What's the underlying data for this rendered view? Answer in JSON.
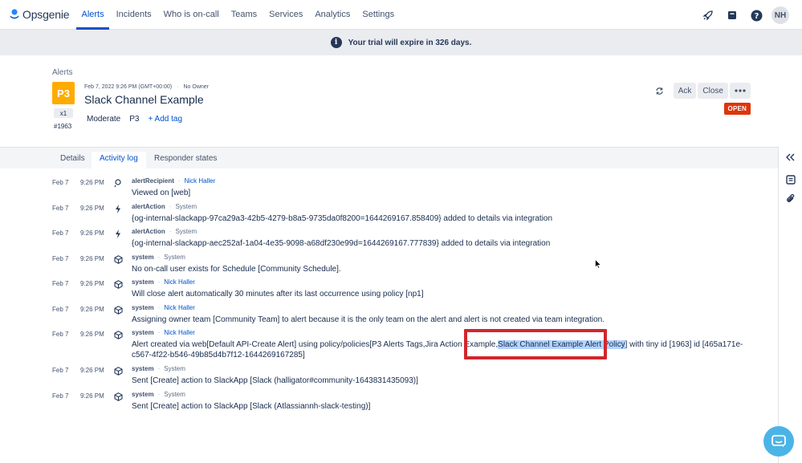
{
  "app": {
    "name": "Opsgenie"
  },
  "nav": {
    "items": [
      "Alerts",
      "Incidents",
      "Who is on-call",
      "Teams",
      "Services",
      "Analytics",
      "Settings"
    ],
    "active": "Alerts",
    "icons": [
      "rocket-icon",
      "book-icon",
      "help-icon"
    ],
    "avatar": "NH"
  },
  "banner": {
    "text": "Your trial will expire in 326 days."
  },
  "alert": {
    "breadcrumb": "Alerts",
    "priority": "P3",
    "count": "x1",
    "tiny_id": "#1963",
    "created": "Feb 7, 2022 9:26 PM (GMT+00:00)",
    "owner": "No Owner",
    "title": "Slack Channel Example",
    "tags": [
      "Moderate",
      "P3"
    ],
    "add_tag": "+ Add tag",
    "status": "OPEN",
    "ack_label": "Ack",
    "close_label": "Close"
  },
  "tabs": [
    "Details",
    "Activity log",
    "Responder states"
  ],
  "active_tab": "Activity log",
  "log": [
    {
      "date": "Feb 7",
      "time": "9:26 PM",
      "icon": "eye",
      "type": "alertRecipient",
      "actor": "Nick Haller",
      "actor_link": true,
      "msg": "Viewed on [web]"
    },
    {
      "date": "Feb 7",
      "time": "9:26 PM",
      "icon": "bolt",
      "type": "alertAction",
      "actor": "System",
      "actor_link": false,
      "msg": "{og-internal-slackapp-97ca29a3-42b5-4279-b8a5-9735da0f8200=1644269167.858409} added to details via integration"
    },
    {
      "date": "Feb 7",
      "time": "9:26 PM",
      "icon": "bolt",
      "type": "alertAction",
      "actor": "System",
      "actor_link": false,
      "msg": "{og-internal-slackapp-aec252af-1a04-4e35-9098-a68df230e99d=1644269167.777839} added to details via integration"
    },
    {
      "date": "Feb 7",
      "time": "9:26 PM",
      "icon": "cube",
      "type": "system",
      "actor": "System",
      "actor_link": false,
      "msg": "No on-call user exists for Schedule [Community Schedule]."
    },
    {
      "date": "Feb 7",
      "time": "9:26 PM",
      "icon": "cube",
      "type": "system",
      "actor": "Nick Haller",
      "actor_link": true,
      "msg": "Will close alert automatically 30 minutes after its last occurrence using policy [np1]"
    },
    {
      "date": "Feb 7",
      "time": "9:26 PM",
      "icon": "cube",
      "type": "system",
      "actor": "Nick Haller",
      "actor_link": true,
      "msg": "Assigning owner team [Community Team] to alert because it is the only team on the alert and alert is not created via team integration."
    },
    {
      "date": "Feb 7",
      "time": "9:26 PM",
      "icon": "cube",
      "type": "system",
      "actor": "Nick Haller",
      "actor_link": true,
      "msg_pre": "Alert created via web[Default API-Create Alert] using policy/policies[P3 Alerts Tags,Jira Action Example,",
      "msg_hl": "Slack Channel Example Alert Policy",
      "msg_post": "] with tiny id [1963] id [465a171e-c567-4f22-b546-49b85d4b7f12-1644269167285]"
    },
    {
      "date": "Feb 7",
      "time": "9:26 PM",
      "icon": "cube",
      "type": "system",
      "actor": "System",
      "actor_link": false,
      "msg": "Sent [Create] action to SlackApp [Slack (halligator#community-1643831435093)]"
    },
    {
      "date": "Feb 7",
      "time": "9:26 PM",
      "icon": "cube",
      "type": "system",
      "actor": "System",
      "actor_link": false,
      "msg": "Sent [Create] action to SlackApp [Slack (Atlassiannh-slack-testing)]"
    }
  ],
  "colors": {
    "brand": "#0052cc",
    "priority": "#ffab00",
    "open": "#de350b",
    "highlight_box": "#d0272d"
  }
}
